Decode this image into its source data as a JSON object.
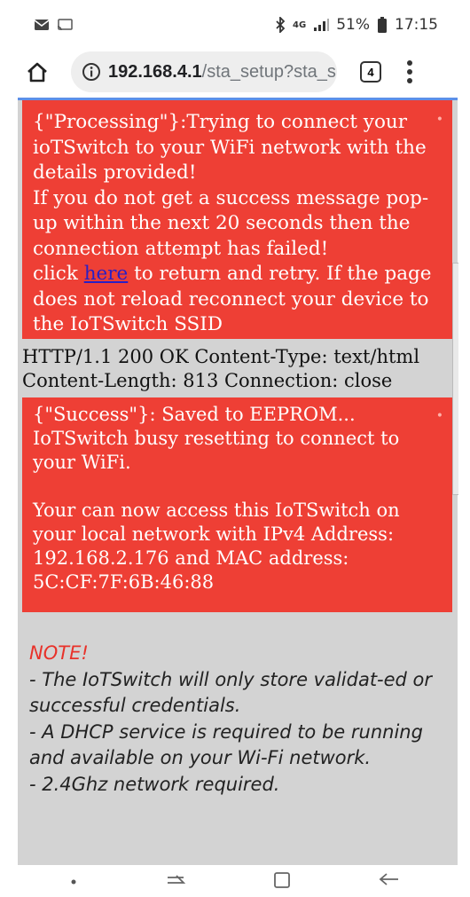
{
  "status_bar": {
    "left_icons": [
      "message-icon",
      "cast-icon"
    ],
    "right_icons": [
      "bluetooth-icon",
      "signal-icon",
      "battery-icon"
    ],
    "network": "4G",
    "battery": "51%",
    "time": "17:15"
  },
  "browser": {
    "url_host": "192.168.4.1",
    "url_path": "/sta_setup?sta_s",
    "tab_count": "4",
    "accent": "#5d8fe8"
  },
  "page": {
    "processing_box": {
      "line1": "{\"Processing\"}:Trying to connect your ioTSwitch to your WiFi network with the details provided!",
      "line2": "If you do not get a success message pop-up within the next 20 seconds then the connection attempt has failed!",
      "line3_before": "click ",
      "link": "here",
      "line3_after": " to return and retry. If the page does not reload reconnect your device to the IoTSwitch SSID"
    },
    "http_header": "HTTP/1.1 200 OK Content-Type: text/html Content-Length: 813 Connection: close",
    "success_box": {
      "line1": "{\"Success\"}: Saved to EEPROM... IoTSwitch busy resetting to connect to your WiFi.",
      "line2": "Your can now access this IoTSwitch on your local network with IPv4 Address: 192.168.2.176 and MAC address: 5C:CF:7F:6B:46:88"
    },
    "note": {
      "title": "NOTE!",
      "items": [
        "- The IoTSwitch will only store validat-ed or successful credentials.",
        "- A DHCP service is required to be running and available on your Wi-Fi network.",
        "- 2.4Ghz network required."
      ]
    },
    "colors": {
      "alert_red": "#ee3f35",
      "page_gray": "#d3d3d3",
      "note_red": "#e8322a"
    }
  },
  "nav_bar": {
    "icons": [
      "dot-icon",
      "recent-apps-icon",
      "home-square-icon",
      "back-icon"
    ]
  }
}
